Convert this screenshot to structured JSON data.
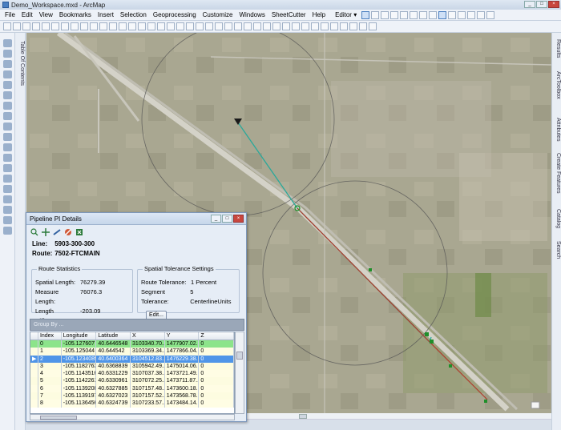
{
  "window": {
    "title": "Demo_Workspace.mxd - ArcMap"
  },
  "menu": [
    "File",
    "Edit",
    "View",
    "Bookmarks",
    "Insert",
    "Selection",
    "Geoprocessing",
    "Customize",
    "Windows",
    "SheetCutter",
    "Help"
  ],
  "editor_label": "Editor",
  "left_tab_label": "Table Of Contents",
  "right_tabs": [
    "Results",
    "ArcToolbox",
    "Attributes",
    "Create Features",
    "Catalog",
    "Search"
  ],
  "panel": {
    "title": "Pipeline PI Details",
    "line_key": "Line:",
    "line_val": "5903-300-300",
    "route_key": "Route:",
    "route_val": "7502-FTCMAIN",
    "route_stats": {
      "title": "Route Statistics",
      "rows": [
        {
          "k": "Spatial Length:",
          "v": "76279.39"
        },
        {
          "k": "Measure Length:",
          "v": "76076.3"
        },
        {
          "k": "Length Difference:",
          "v": "-203.09"
        }
      ]
    },
    "tolerance": {
      "title": "Spatial Tolerance Settings",
      "rows": [
        {
          "k": "Route Tolerance:",
          "v": "1 Percent"
        },
        {
          "k": "Segment Tolerance:",
          "v": "5 CenterlineUnits"
        }
      ],
      "edit_label": "Edit..."
    },
    "group_by": "Group By ...",
    "columns": [
      "",
      "Index",
      "Longitude",
      "Latitude",
      "X",
      "Y",
      "Z"
    ],
    "rows": [
      {
        "sel": "",
        "cells": [
          "0",
          "-105.127607",
          "40.6446548",
          "3103340.70...",
          "1477907.02...",
          "0"
        ],
        "style": "green"
      },
      {
        "sel": "",
        "cells": [
          "1",
          "-105.125044",
          "40.644542",
          "3103369.34...",
          "1477866.04...",
          "0"
        ],
        "style": "alt"
      },
      {
        "sel": "▶",
        "cells": [
          "2",
          "-105.1234089",
          "40.6400364",
          "3104512.83...",
          "1476229.38...",
          "0"
        ],
        "style": "sel"
      },
      {
        "sel": "",
        "cells": [
          "3",
          "-105.1182763",
          "40.6368839",
          "3105942.49...",
          "1475014.06...",
          "0"
        ],
        "style": "alt"
      },
      {
        "sel": "",
        "cells": [
          "4",
          "-105.1143516",
          "40.6331229",
          "3107037.38...",
          "1473721.49...",
          "0"
        ],
        "style": "norm"
      },
      {
        "sel": "",
        "cells": [
          "5",
          "-105.1142261",
          "40.6330961",
          "3107072.25...",
          "1473711.87...",
          "0"
        ],
        "style": "alt"
      },
      {
        "sel": "",
        "cells": [
          "6",
          "-105.1139208",
          "40.6327885",
          "3107157.48...",
          "1473600.18...",
          "0"
        ],
        "style": "norm"
      },
      {
        "sel": "",
        "cells": [
          "7",
          "-105.1139197",
          "40.6327023",
          "3107157.52...",
          "1473568.78...",
          "0"
        ],
        "style": "alt"
      },
      {
        "sel": "",
        "cells": [
          "8",
          "-105.1136456",
          "40.6324739",
          "3107233.57...",
          "1473484.14...",
          "0"
        ],
        "style": "norm"
      }
    ]
  },
  "colors": {
    "route_line": "#2aa89a",
    "red_line": "#b03a2a",
    "vertex": "#1f8f2a",
    "selected_row": "#4f95e8",
    "green_row": "#8ce48a"
  }
}
